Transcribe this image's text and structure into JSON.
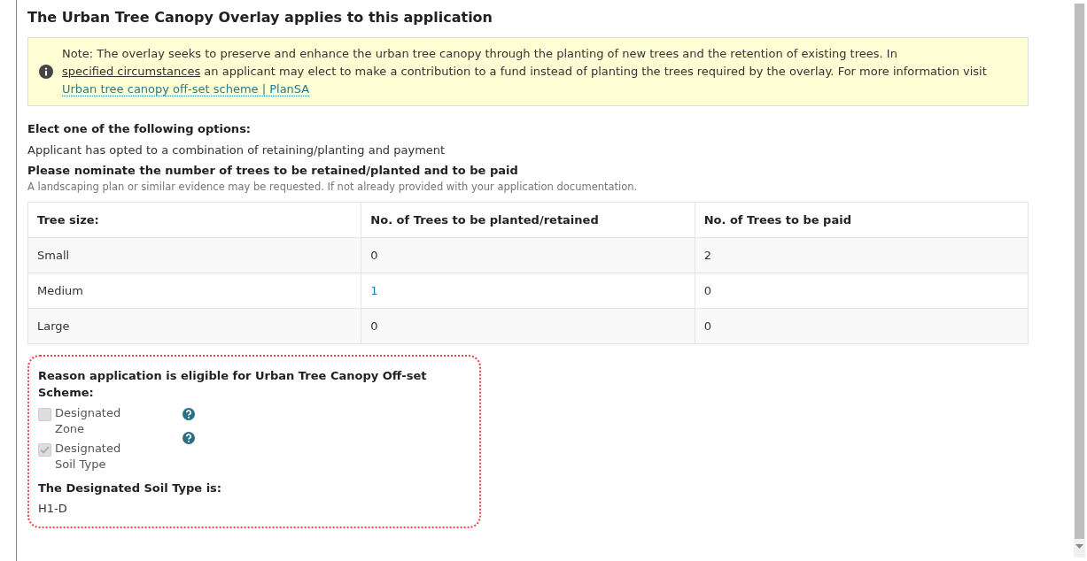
{
  "title": "The Urban Tree Canopy Overlay applies to this application",
  "note": {
    "text_before": "Note: The overlay seeks to preserve and enhance the urban tree canopy through the planting of new trees and the retention of existing trees. In ",
    "link_1": "specified circumstances",
    "text_middle": " an applicant may elect to make a contribution to a fund instead of planting the trees required by the overlay. For more information visit ",
    "link_2": "Urban tree canopy off-set scheme | PlanSA"
  },
  "option_label": "Elect one of the following options:",
  "option_value": "Applicant has opted to a combination of retaining/planting and payment",
  "nominate_label": "Please nominate the number of trees to be retained/planted and to be paid",
  "nominate_hint": "A landscaping plan or similar evidence may be requested. If not already provided with your application documentation.",
  "table": {
    "columns": [
      "Tree size:",
      "No. of Trees to be planted/retained",
      "No. of Trees to be paid"
    ],
    "rows": [
      {
        "size": "Small",
        "planted": "0",
        "paid": "2",
        "planted_link": false
      },
      {
        "size": "Medium",
        "planted": "1",
        "paid": "0",
        "planted_link": true
      },
      {
        "size": "Large",
        "planted": "0",
        "paid": "0",
        "planted_link": false
      }
    ]
  },
  "eligibility": {
    "label": "Reason application is eligible for Urban Tree Canopy Off-set Scheme:",
    "options": [
      {
        "label": "Designated Zone",
        "checked": false,
        "disabled": true
      },
      {
        "label": "Designated Soil Type",
        "checked": true,
        "disabled": true
      }
    ],
    "soil_label": "The Designated Soil Type is:",
    "soil_value": "H1-D"
  }
}
